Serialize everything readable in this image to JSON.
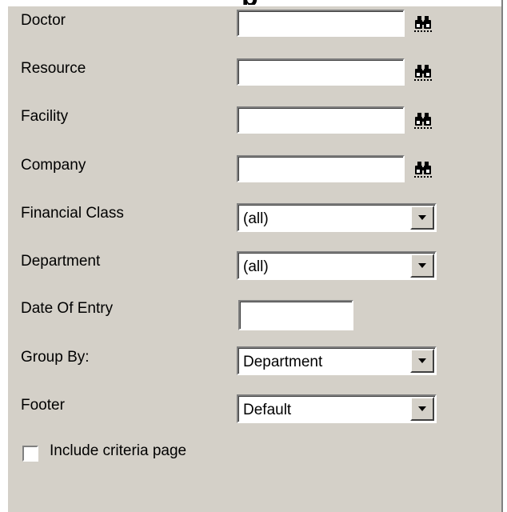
{
  "window": {
    "title_fragment": "p"
  },
  "form": {
    "doctor_label": "Doctor",
    "doctor_value": "",
    "resource_label": "Resource",
    "resource_value": "",
    "facility_label": "Facility",
    "facility_value": "",
    "company_label": "Company",
    "company_value": "",
    "financial_class_label": "Financial Class",
    "financial_class_value": "(all)",
    "department_label": "Department",
    "department_value": "(all)",
    "date_of_entry_label": "Date Of Entry",
    "date_of_entry_value": "",
    "group_by_label": "Group By:",
    "group_by_value": "Department",
    "footer_label": "Footer",
    "footer_value": "Default",
    "include_criteria_label": "Include criteria page",
    "include_criteria_checked": false
  },
  "icons": {
    "lookup": "binoculars-icon",
    "dropdown": "chevron-down-icon"
  }
}
